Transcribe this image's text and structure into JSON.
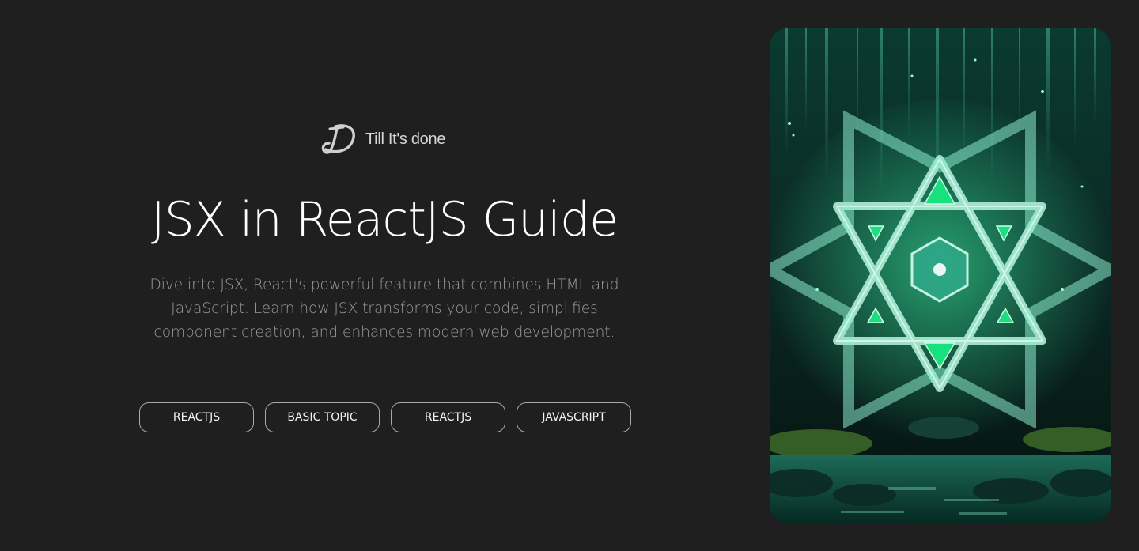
{
  "brand": {
    "name": "Till It's done",
    "logo_icon": "td-monogram-icon"
  },
  "hero": {
    "title": "JSX in ReactJS Guide",
    "description": "Dive into JSX, React's powerful feature that combines HTML and JavaScript. Learn how JSX transforms your code, simplifies component creation, and enhances modern web development."
  },
  "tags": [
    {
      "label": "REACTJS"
    },
    {
      "label": "BASIC TOPIC"
    },
    {
      "label": "REACTJS"
    },
    {
      "label": "JAVASCRIPT"
    }
  ],
  "image": {
    "icon": "react-crystal-illustration"
  },
  "colors": {
    "background": "#1f1f1f",
    "accent": "#2ee89a",
    "title": "#ffffff",
    "muted": "#9b9b9b"
  }
}
